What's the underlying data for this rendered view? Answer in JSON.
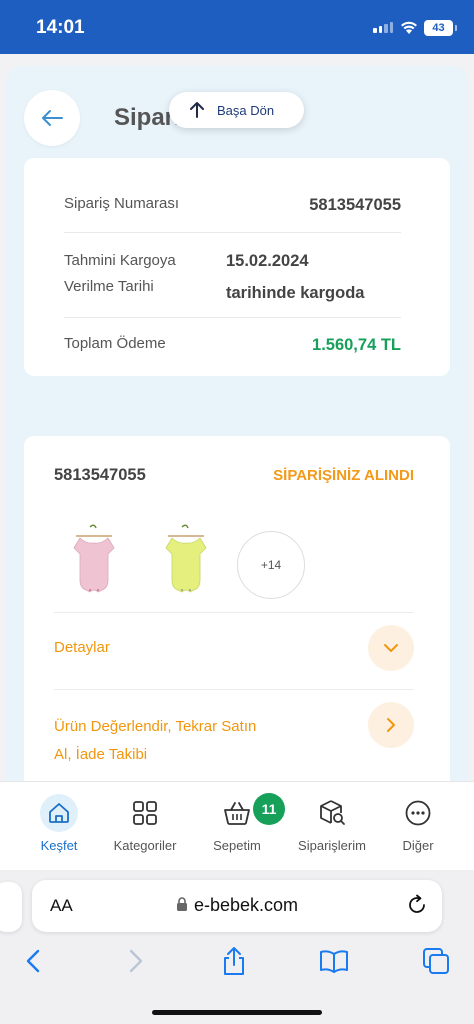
{
  "status_bar": {
    "time": "14:01",
    "battery": "43"
  },
  "header": {
    "title": "Sipariş",
    "back_to_top": "Başa Dön"
  },
  "order_info": {
    "number_label": "Sipariş Numarası",
    "number_value": "5813547055",
    "cargo_label_line1": "Tahmini Kargoya",
    "cargo_label_line2": "Verilme Tarihi",
    "cargo_date": "15.02.2024",
    "cargo_note": "tarihinde kargoda",
    "total_label": "Toplam Ödeme",
    "total_value": "1.560,74 TL"
  },
  "order_card": {
    "order_number": "5813547055",
    "status": "SİPARİŞİNİZ ALINDI",
    "more_count": "+14",
    "details_label": "Detaylar",
    "review_line1": "Ürün Değerlendir, Tekrar Satın",
    "review_line2": "Al, İade Takibi"
  },
  "bottom_nav": {
    "items": [
      {
        "label": "Keşfet",
        "icon": "home-icon",
        "active": true
      },
      {
        "label": "Kategoriler",
        "icon": "grid-icon",
        "active": false
      },
      {
        "label": "Sepetim",
        "icon": "basket-icon",
        "active": false
      },
      {
        "label": "Siparişlerim",
        "icon": "package-search-icon",
        "active": false
      },
      {
        "label": "Diğer",
        "icon": "more-icon",
        "active": false
      }
    ],
    "cart_count": "11"
  },
  "browser": {
    "text_size": "AA",
    "url": "e-bebek.com"
  },
  "colors": {
    "status_bar": "#1e5ec0",
    "accent_orange": "#f39a1a",
    "price_green": "#17a05a",
    "active_blue": "#1a6fc6",
    "page_bg": "#e8f3fa"
  }
}
